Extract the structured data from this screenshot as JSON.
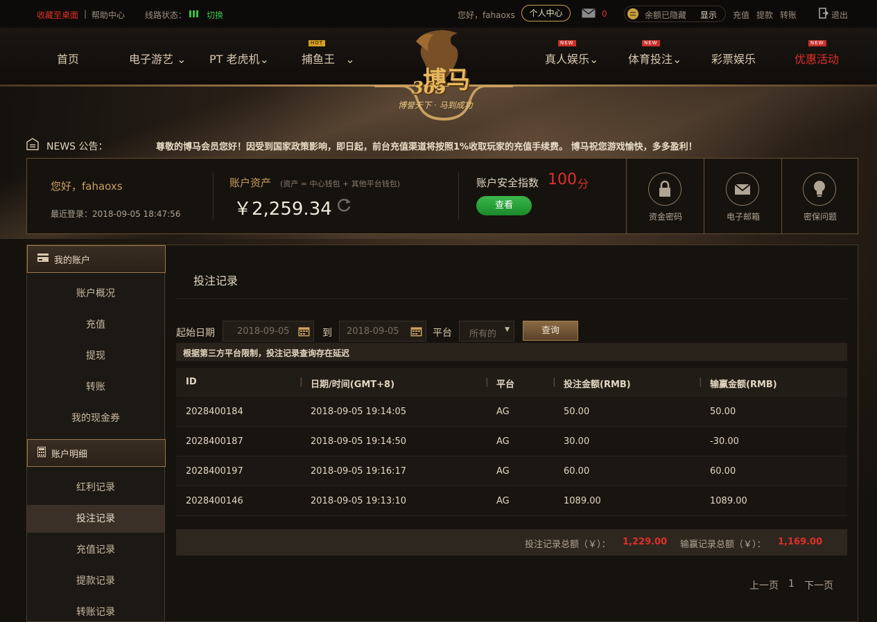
{
  "topbar": {
    "fav": "收藏至桌面",
    "sep": "|",
    "help": "帮助中心",
    "line_label": "线路状态：",
    "switch": "切换",
    "greeting": "您好，fahaoxs",
    "personal_center": "个人中心",
    "mail_count": "0",
    "balance_hidden": "余额已隐藏",
    "show": "显示",
    "deposit": "充值",
    "withdraw": "提款",
    "transfer": "转账",
    "logout": "退出"
  },
  "nav": {
    "items": [
      {
        "label": "首页"
      },
      {
        "label": "电子游艺"
      },
      {
        "label": "PT 老虎机"
      },
      {
        "label": "捕鱼王"
      },
      {
        "label": "真人娱乐"
      },
      {
        "label": "体育投注"
      },
      {
        "label": "彩票娱乐"
      },
      {
        "label": "优惠活动"
      }
    ],
    "badge_hot": "HOT",
    "badge_new": "NEW",
    "logo_main": "博马",
    "logo_num": "365",
    "logo_slogan": "博誉天下 · 马到成功"
  },
  "news": {
    "label": "NEWS 公告：",
    "text": "尊敬的博马会员您好！因受到国家政策影响，即日起，前台充值渠道将按照1%收取玩家的充值手续费。 博马祝您游戏愉快，多多盈利！"
  },
  "account": {
    "greeting": "您好，fahaoxs",
    "last_login": "最近登录：2018-09-05 18:47:56",
    "assets_label": "账户资产",
    "assets_note": "(资产 = 中心钱包 + 其他平台钱包)",
    "assets_value": "￥2,259.34",
    "security_label": "账户安全指数",
    "security_score": "100",
    "security_unit": "分",
    "check_button": "查看",
    "icons": [
      {
        "label": "资金密码",
        "icon": "lock-icon"
      },
      {
        "label": "电子邮箱",
        "icon": "mail-icon"
      },
      {
        "label": "密保问题",
        "icon": "bulb-icon"
      }
    ]
  },
  "sidebar": {
    "section1": "我的账户",
    "items1": [
      "账户概况",
      "充值",
      "提现",
      "转账",
      "我的现金券"
    ],
    "section2": "账户明细",
    "items2": [
      "红利记录",
      "投注记录",
      "充值记录",
      "提款记录",
      "转账记录"
    ],
    "active": "投注记录"
  },
  "main": {
    "title": "投注记录",
    "start_label": "起始日期",
    "start_value": "2018-09-05",
    "to_label": "到",
    "end_value": "2018-09-05",
    "platform_label": "平台",
    "platform_value": "所有的",
    "query_button": "查询",
    "notice": "根据第三方平台限制，投注记录查询存在延迟",
    "columns": [
      "ID",
      "日期/时间(GMT+8)",
      "平台",
      "投注金额(RMB)",
      "输赢金额(RMB)"
    ],
    "rows": [
      [
        "2028400184",
        "2018-09-05 19:14:05",
        "AG",
        "50.00",
        "50.00"
      ],
      [
        "2028400187",
        "2018-09-05 19:14:50",
        "AG",
        "30.00",
        "-30.00"
      ],
      [
        "2028400197",
        "2018-09-05 19:16:17",
        "AG",
        "60.00",
        "60.00"
      ],
      [
        "2028400146",
        "2018-09-05 19:13:10",
        "AG",
        "1089.00",
        "1089.00"
      ]
    ],
    "total_bet_label": "投注记录总额（￥）：",
    "total_bet_value": "1,229.00",
    "total_win_label": "输赢记录总额（￥）：",
    "total_win_value": "1,169.00",
    "prev": "上一页",
    "page": "1",
    "next": "下一页"
  },
  "colors": {
    "accent_red": "#e0302a",
    "gold": "#c9a060",
    "green": "#2a9a3a"
  }
}
